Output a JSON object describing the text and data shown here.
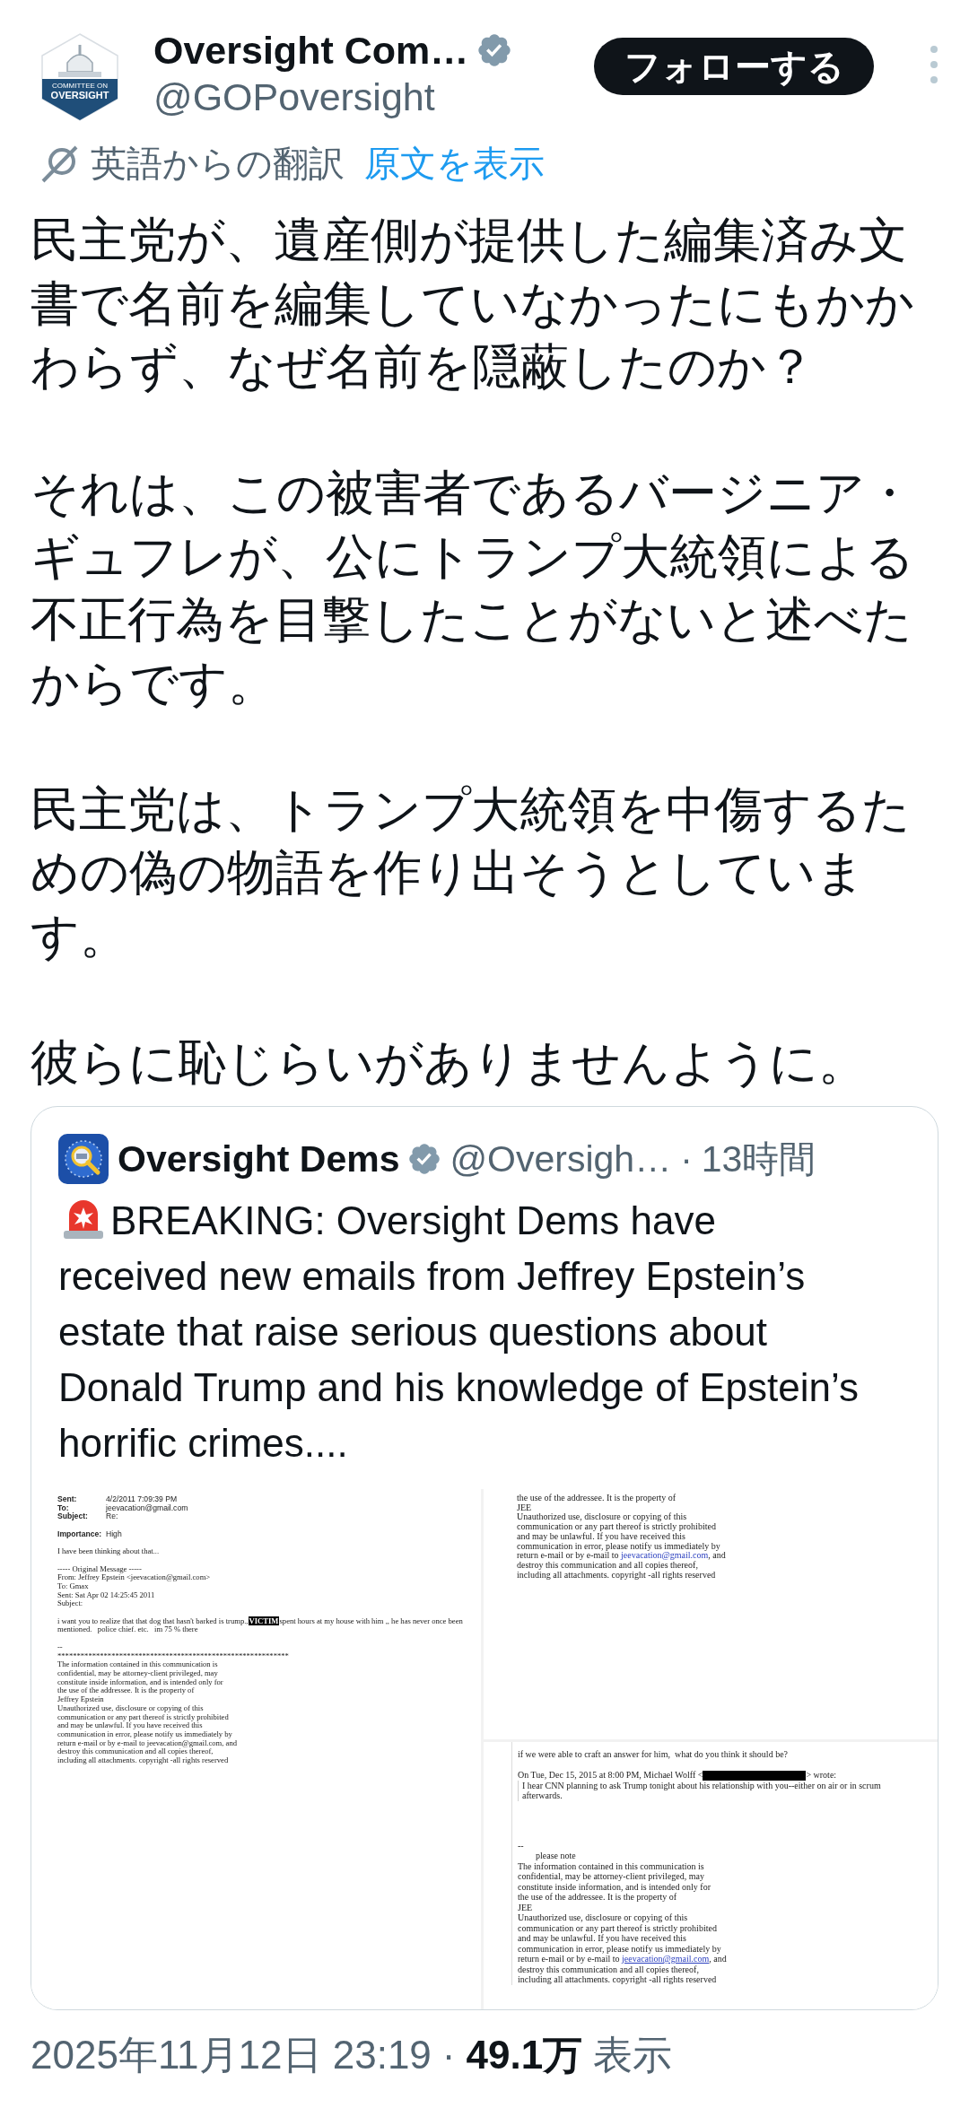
{
  "author": {
    "name": "Oversight Com…",
    "verified": true,
    "handle": "@GOPoversight",
    "avatar_text": [
      "COMMITTEE ON",
      "OVERSIGHT"
    ]
  },
  "follow_button": "フォローする",
  "translation": {
    "note": "英語からの翻訳",
    "link": "原文を表示"
  },
  "paragraphs": [
    "民主党が、遺産側が提供した編集済み文書で名前を編集していなかったにもかかわらず、なぜ名前を隠蔽したのか？",
    "それは、この被害者であるバージニア・ギュフレが、公にトランプ大統領による不正行為を目撃したことがないと述べたからです。",
    "民主党は、トランプ大統領を中傷するための偽の物語を作り出そうとしています。",
    "彼らに恥じらいがありませんように。"
  ],
  "quote": {
    "author": {
      "name": "Oversight Dems",
      "verified": true,
      "handle": "@Oversigh…",
      "separator": "·",
      "time": "13時間"
    },
    "text": "BREAKING: Oversight Dems have received new emails from Jeffrey Epstein’s estate that raise serious questions about Donald Trump and his knowledge of Epstein’s horrific crimes....",
    "documents": [
      {
        "blocks": [
          [
            {
              "kind": "field",
              "label": "Sent:",
              "value": "4/2/2011 7:09:39 PM"
            },
            {
              "kind": "field",
              "label": "To:",
              "value": "jeevacation@gmail.com"
            },
            {
              "kind": "field",
              "label": "Subject:",
              "value": "Re:"
            }
          ],
          [
            {
              "kind": "field",
              "label": "Importance:",
              "value": "High"
            }
          ],
          [
            {
              "kind": "text",
              "parts": [
                {
                  "kind": "plain",
                  "text": "I have been thinking about that..."
                }
              ]
            }
          ],
          [
            {
              "kind": "text",
              "parts": [
                {
                  "kind": "plain",
                  "text": "----- Original Message -----"
                }
              ]
            },
            {
              "kind": "text",
              "parts": [
                {
                  "kind": "plain",
                  "text": "From: Jeffrey Epstein <jeevacation@gmail.com>"
                }
              ]
            },
            {
              "kind": "text",
              "parts": [
                {
                  "kind": "plain",
                  "text": "To: Gmax"
                }
              ]
            },
            {
              "kind": "text",
              "parts": [
                {
                  "kind": "plain",
                  "text": "Sent: Sat Apr 02 14:25:45 2011"
                }
              ]
            },
            {
              "kind": "text",
              "parts": [
                {
                  "kind": "plain",
                  "text": "Subject:"
                }
              ]
            }
          ],
          [
            {
              "kind": "text",
              "parts": [
                {
                  "kind": "plain",
                  "text": "i want you to realize that that dog that hasn't barked is trump.,"
                },
                {
                  "kind": "redacted",
                  "text": "VICTIM"
                },
                {
                  "kind": "plain",
                  "text": "spent hours at my house with him ,, he has never once been"
                }
              ]
            },
            {
              "kind": "text",
              "parts": [
                {
                  "kind": "plain",
                  "text": "mentioned.   police chief. etc.   im 75 % there"
                }
              ]
            }
          ],
          [
            {
              "kind": "text",
              "parts": [
                {
                  "kind": "plain",
                  "text": "--"
                }
              ]
            },
            {
              "kind": "text",
              "parts": [
                {
                  "kind": "plain",
                  "text": "************************************************************"
                }
              ]
            },
            {
              "kind": "text",
              "parts": [
                {
                  "kind": "plain",
                  "text": "The information contained in this communication is"
                }
              ]
            },
            {
              "kind": "text",
              "parts": [
                {
                  "kind": "plain",
                  "text": "confidential, may be attorney-client privileged, may"
                }
              ]
            },
            {
              "kind": "text",
              "parts": [
                {
                  "kind": "plain",
                  "text": "constitute inside information, and is intended only for"
                }
              ]
            },
            {
              "kind": "text",
              "parts": [
                {
                  "kind": "plain",
                  "text": "the use of the addressee. It is the property of"
                }
              ]
            },
            {
              "kind": "text",
              "parts": [
                {
                  "kind": "plain",
                  "text": "Jeffrey Epstein"
                }
              ]
            },
            {
              "kind": "text",
              "parts": [
                {
                  "kind": "plain",
                  "text": "Unauthorized use, disclosure or copying of this"
                }
              ]
            },
            {
              "kind": "text",
              "parts": [
                {
                  "kind": "plain",
                  "text": "communication or any part thereof is strictly prohibited"
                }
              ]
            },
            {
              "kind": "text",
              "parts": [
                {
                  "kind": "plain",
                  "text": "and may be unlawful. If you have received this"
                }
              ]
            },
            {
              "kind": "text",
              "parts": [
                {
                  "kind": "plain",
                  "text": "communication in error, please notify us immediately by"
                }
              ]
            },
            {
              "kind": "text",
              "parts": [
                {
                  "kind": "plain",
                  "text": "return e-mail or by e-mail to jeevacation@gmail.com, and"
                }
              ]
            },
            {
              "kind": "text",
              "parts": [
                {
                  "kind": "plain",
                  "text": "destroy this communication and all copies thereof,"
                }
              ]
            },
            {
              "kind": "text",
              "parts": [
                {
                  "kind": "plain",
                  "text": "including all attachments. copyright -all rights reserved"
                }
              ]
            }
          ]
        ]
      },
      {
        "blocks": [
          [
            {
              "kind": "text",
              "parts": [
                {
                  "kind": "plain",
                  "text": "the use of the addressee. It is the property of"
                }
              ]
            },
            {
              "kind": "text",
              "parts": [
                {
                  "kind": "plain",
                  "text": "JEE"
                }
              ]
            },
            {
              "kind": "text",
              "parts": [
                {
                  "kind": "plain",
                  "text": "Unauthorized use, disclosure or copying of this"
                }
              ]
            },
            {
              "kind": "text",
              "parts": [
                {
                  "kind": "plain",
                  "text": "communication or any part thereof is strictly prohibited"
                }
              ]
            },
            {
              "kind": "text",
              "parts": [
                {
                  "kind": "plain",
                  "text": "and may be unlawful. If you have received this"
                }
              ]
            },
            {
              "kind": "text",
              "parts": [
                {
                  "kind": "plain",
                  "text": "communication in error, please notify us immediately by"
                }
              ]
            },
            {
              "kind": "text",
              "parts": [
                {
                  "kind": "plain",
                  "text": "return e-mail or by e-mail to "
                },
                {
                  "kind": "link",
                  "text": "jeevacation@gmail.com"
                },
                {
                  "kind": "plain",
                  "text": ", and"
                }
              ]
            },
            {
              "kind": "text",
              "parts": [
                {
                  "kind": "plain",
                  "text": "destroy this communication and all copies thereof,"
                }
              ]
            },
            {
              "kind": "text",
              "parts": [
                {
                  "kind": "plain",
                  "text": "including all attachments. copyright -all rights reserved"
                }
              ]
            }
          ]
        ]
      },
      {
        "blocks": [
          [
            {
              "kind": "text",
              "parts": [
                {
                  "kind": "plain",
                  "text": "if we were able to craft an answer for him,  what do you think it should be?"
                }
              ]
            }
          ],
          [
            {
              "kind": "text",
              "parts": [
                {
                  "kind": "plain",
                  "text": "On Tue, Dec 15, 2015 at 8:00 PM, Michael Wolff <"
                },
                {
                  "kind": "blackout"
                },
                {
                  "kind": "plain",
                  "text": "> wrote:"
                }
              ]
            },
            {
              "kind": "text",
              "quoted": true,
              "parts": [
                {
                  "kind": "plain",
                  "text": "I hear CNN planning to ask Trump tonight about his relationship with you--either on air or in scrum"
                }
              ]
            },
            {
              "kind": "text",
              "quoted": true,
              "parts": [
                {
                  "kind": "plain",
                  "text": "afterwards."
                }
              ]
            }
          ],
          [
            {
              "kind": "text",
              "parts": [
                {
                  "kind": "plain",
                  "text": "--"
                }
              ]
            },
            {
              "kind": "text",
              "indent": true,
              "parts": [
                {
                  "kind": "plain",
                  "text": "please note"
                }
              ]
            },
            {
              "kind": "text",
              "parts": [
                {
                  "kind": "plain",
                  "text": "The information contained in this communication is"
                }
              ]
            },
            {
              "kind": "text",
              "parts": [
                {
                  "kind": "plain",
                  "text": "confidential, may be attorney-client privileged, may"
                }
              ]
            },
            {
              "kind": "text",
              "parts": [
                {
                  "kind": "plain",
                  "text": "constitute inside information, and is intended only for"
                }
              ]
            },
            {
              "kind": "text",
              "parts": [
                {
                  "kind": "plain",
                  "text": "the use of the addressee. It is the property of"
                }
              ]
            },
            {
              "kind": "text",
              "parts": [
                {
                  "kind": "plain",
                  "text": "JEE"
                }
              ]
            },
            {
              "kind": "text",
              "parts": [
                {
                  "kind": "plain",
                  "text": "Unauthorized use, disclosure or copying of this"
                }
              ]
            },
            {
              "kind": "text",
              "parts": [
                {
                  "kind": "plain",
                  "text": "communication or any part thereof is strictly prohibited"
                }
              ]
            },
            {
              "kind": "text",
              "parts": [
                {
                  "kind": "plain",
                  "text": "and may be unlawful. If you have received this"
                }
              ]
            },
            {
              "kind": "text",
              "parts": [
                {
                  "kind": "plain",
                  "text": "communication in error, please notify us immediately by"
                }
              ]
            },
            {
              "kind": "text",
              "parts": [
                {
                  "kind": "plain",
                  "text": "return e-mail or by e-mail to "
                },
                {
                  "kind": "underlined-link",
                  "text": "jeevacation@gmail.com"
                },
                {
                  "kind": "plain",
                  "text": ", and"
                }
              ]
            },
            {
              "kind": "text",
              "parts": [
                {
                  "kind": "plain",
                  "text": "destroy this communication and all copies thereof,"
                }
              ]
            },
            {
              "kind": "text",
              "parts": [
                {
                  "kind": "plain",
                  "text": "including all attachments. copyright -all rights reserved"
                }
              ]
            }
          ]
        ]
      }
    ]
  },
  "footer": {
    "date": "2025年11月12日 23:19",
    "separator": "·",
    "views": "49.1万",
    "views_label": "表示"
  }
}
